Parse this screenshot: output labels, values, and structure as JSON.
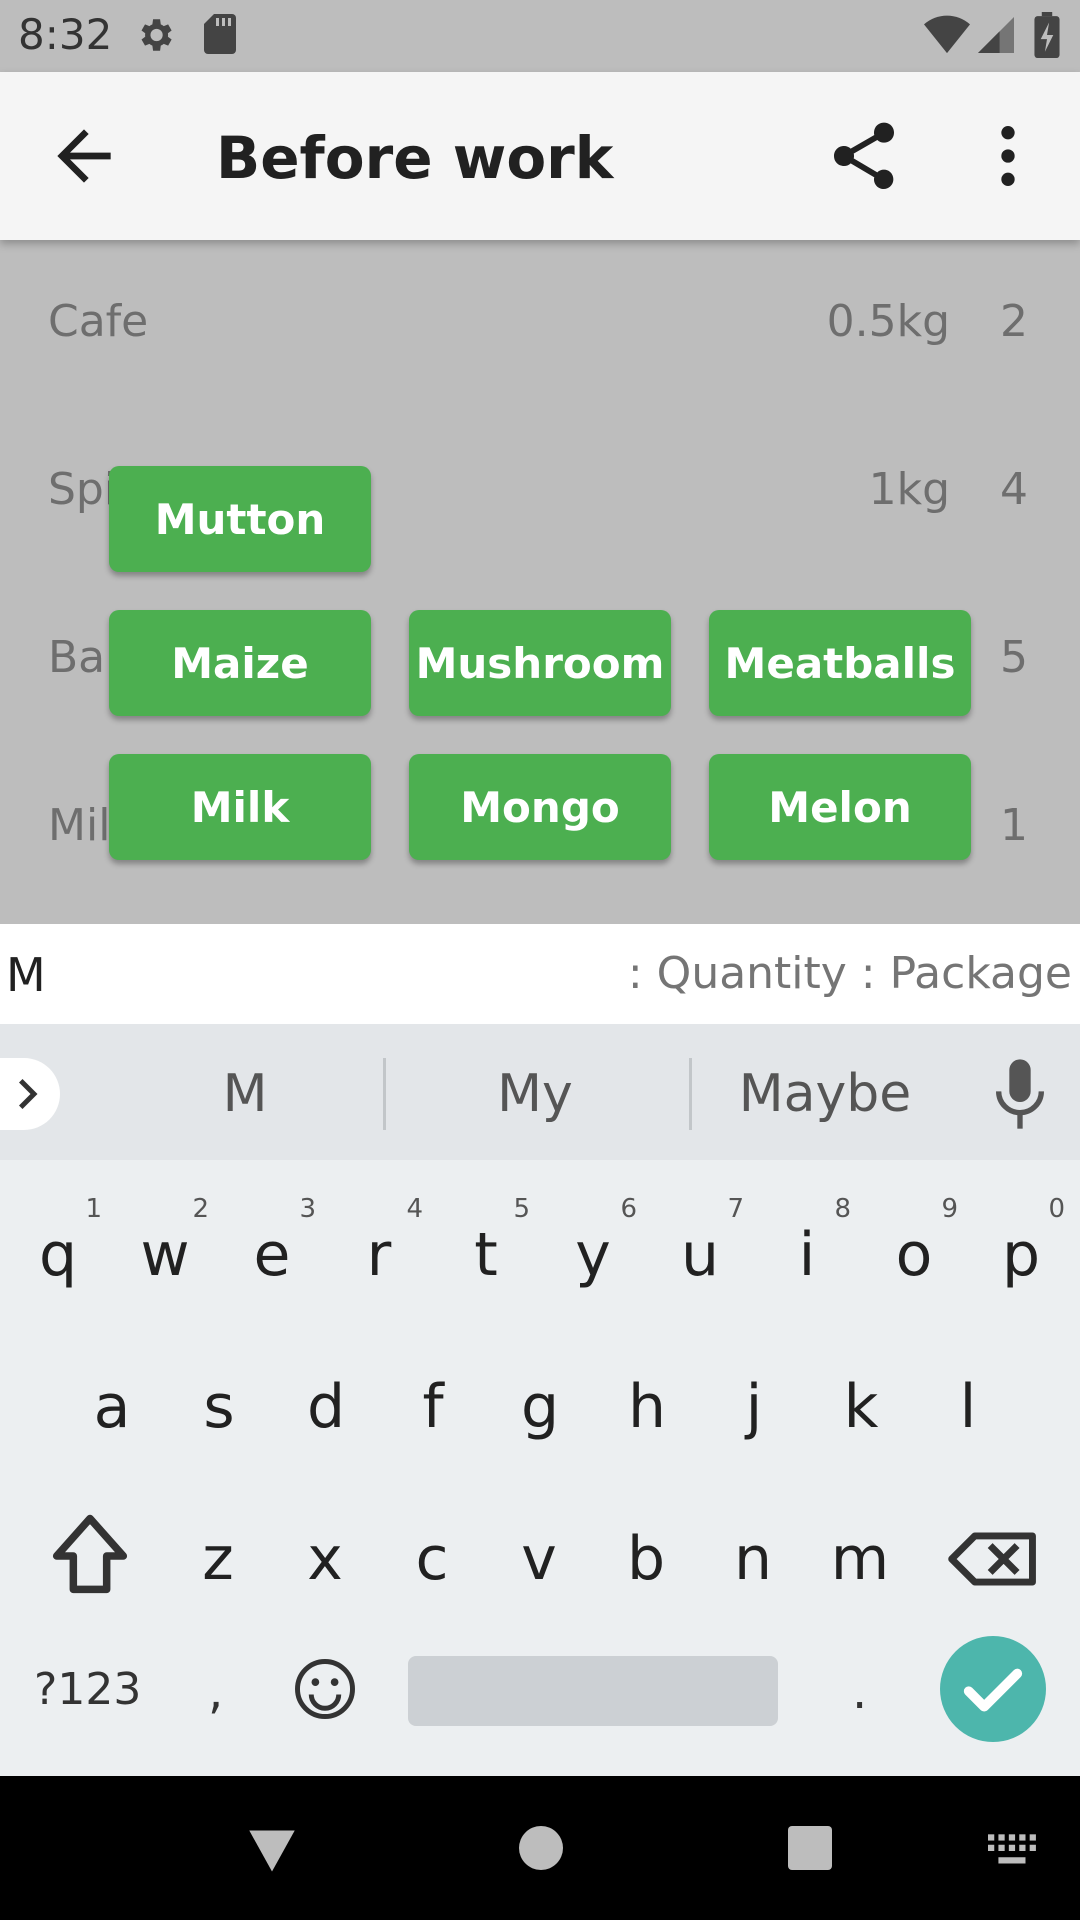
{
  "status_bar": {
    "time": "8:32"
  },
  "app_bar": {
    "title": "Before work"
  },
  "list": [
    {
      "name": "Cafe",
      "package": "0.5kg",
      "quantity": "2"
    },
    {
      "name": "Spi",
      "package": "1kg",
      "quantity": "4"
    },
    {
      "name": "Ba",
      "package": "",
      "quantity": "5"
    },
    {
      "name": "Mil",
      "package": "",
      "quantity": "1"
    }
  ],
  "suggestions": [
    "Mutton",
    "Maize",
    "Mushroom",
    "Meatballs",
    "Milk",
    "Mongo",
    "Melon"
  ],
  "input": {
    "value": "M",
    "hint": ": Quantity : Package"
  },
  "keyboard": {
    "word_suggestions": [
      "M",
      "My",
      "Maybe"
    ],
    "row1": [
      "q",
      "w",
      "e",
      "r",
      "t",
      "y",
      "u",
      "i",
      "o",
      "p"
    ],
    "row1_numbers": [
      "1",
      "2",
      "3",
      "4",
      "5",
      "6",
      "7",
      "8",
      "9",
      "0"
    ],
    "row2": [
      "a",
      "s",
      "d",
      "f",
      "g",
      "h",
      "j",
      "k",
      "l"
    ],
    "row3": [
      "z",
      "x",
      "c",
      "v",
      "b",
      "n",
      "m"
    ],
    "symbols_label": "?123",
    "comma": ",",
    "period": "."
  },
  "colors": {
    "chip": "#4caf50",
    "enter": "#4db6ac",
    "overlay": "#bdbdbd"
  }
}
